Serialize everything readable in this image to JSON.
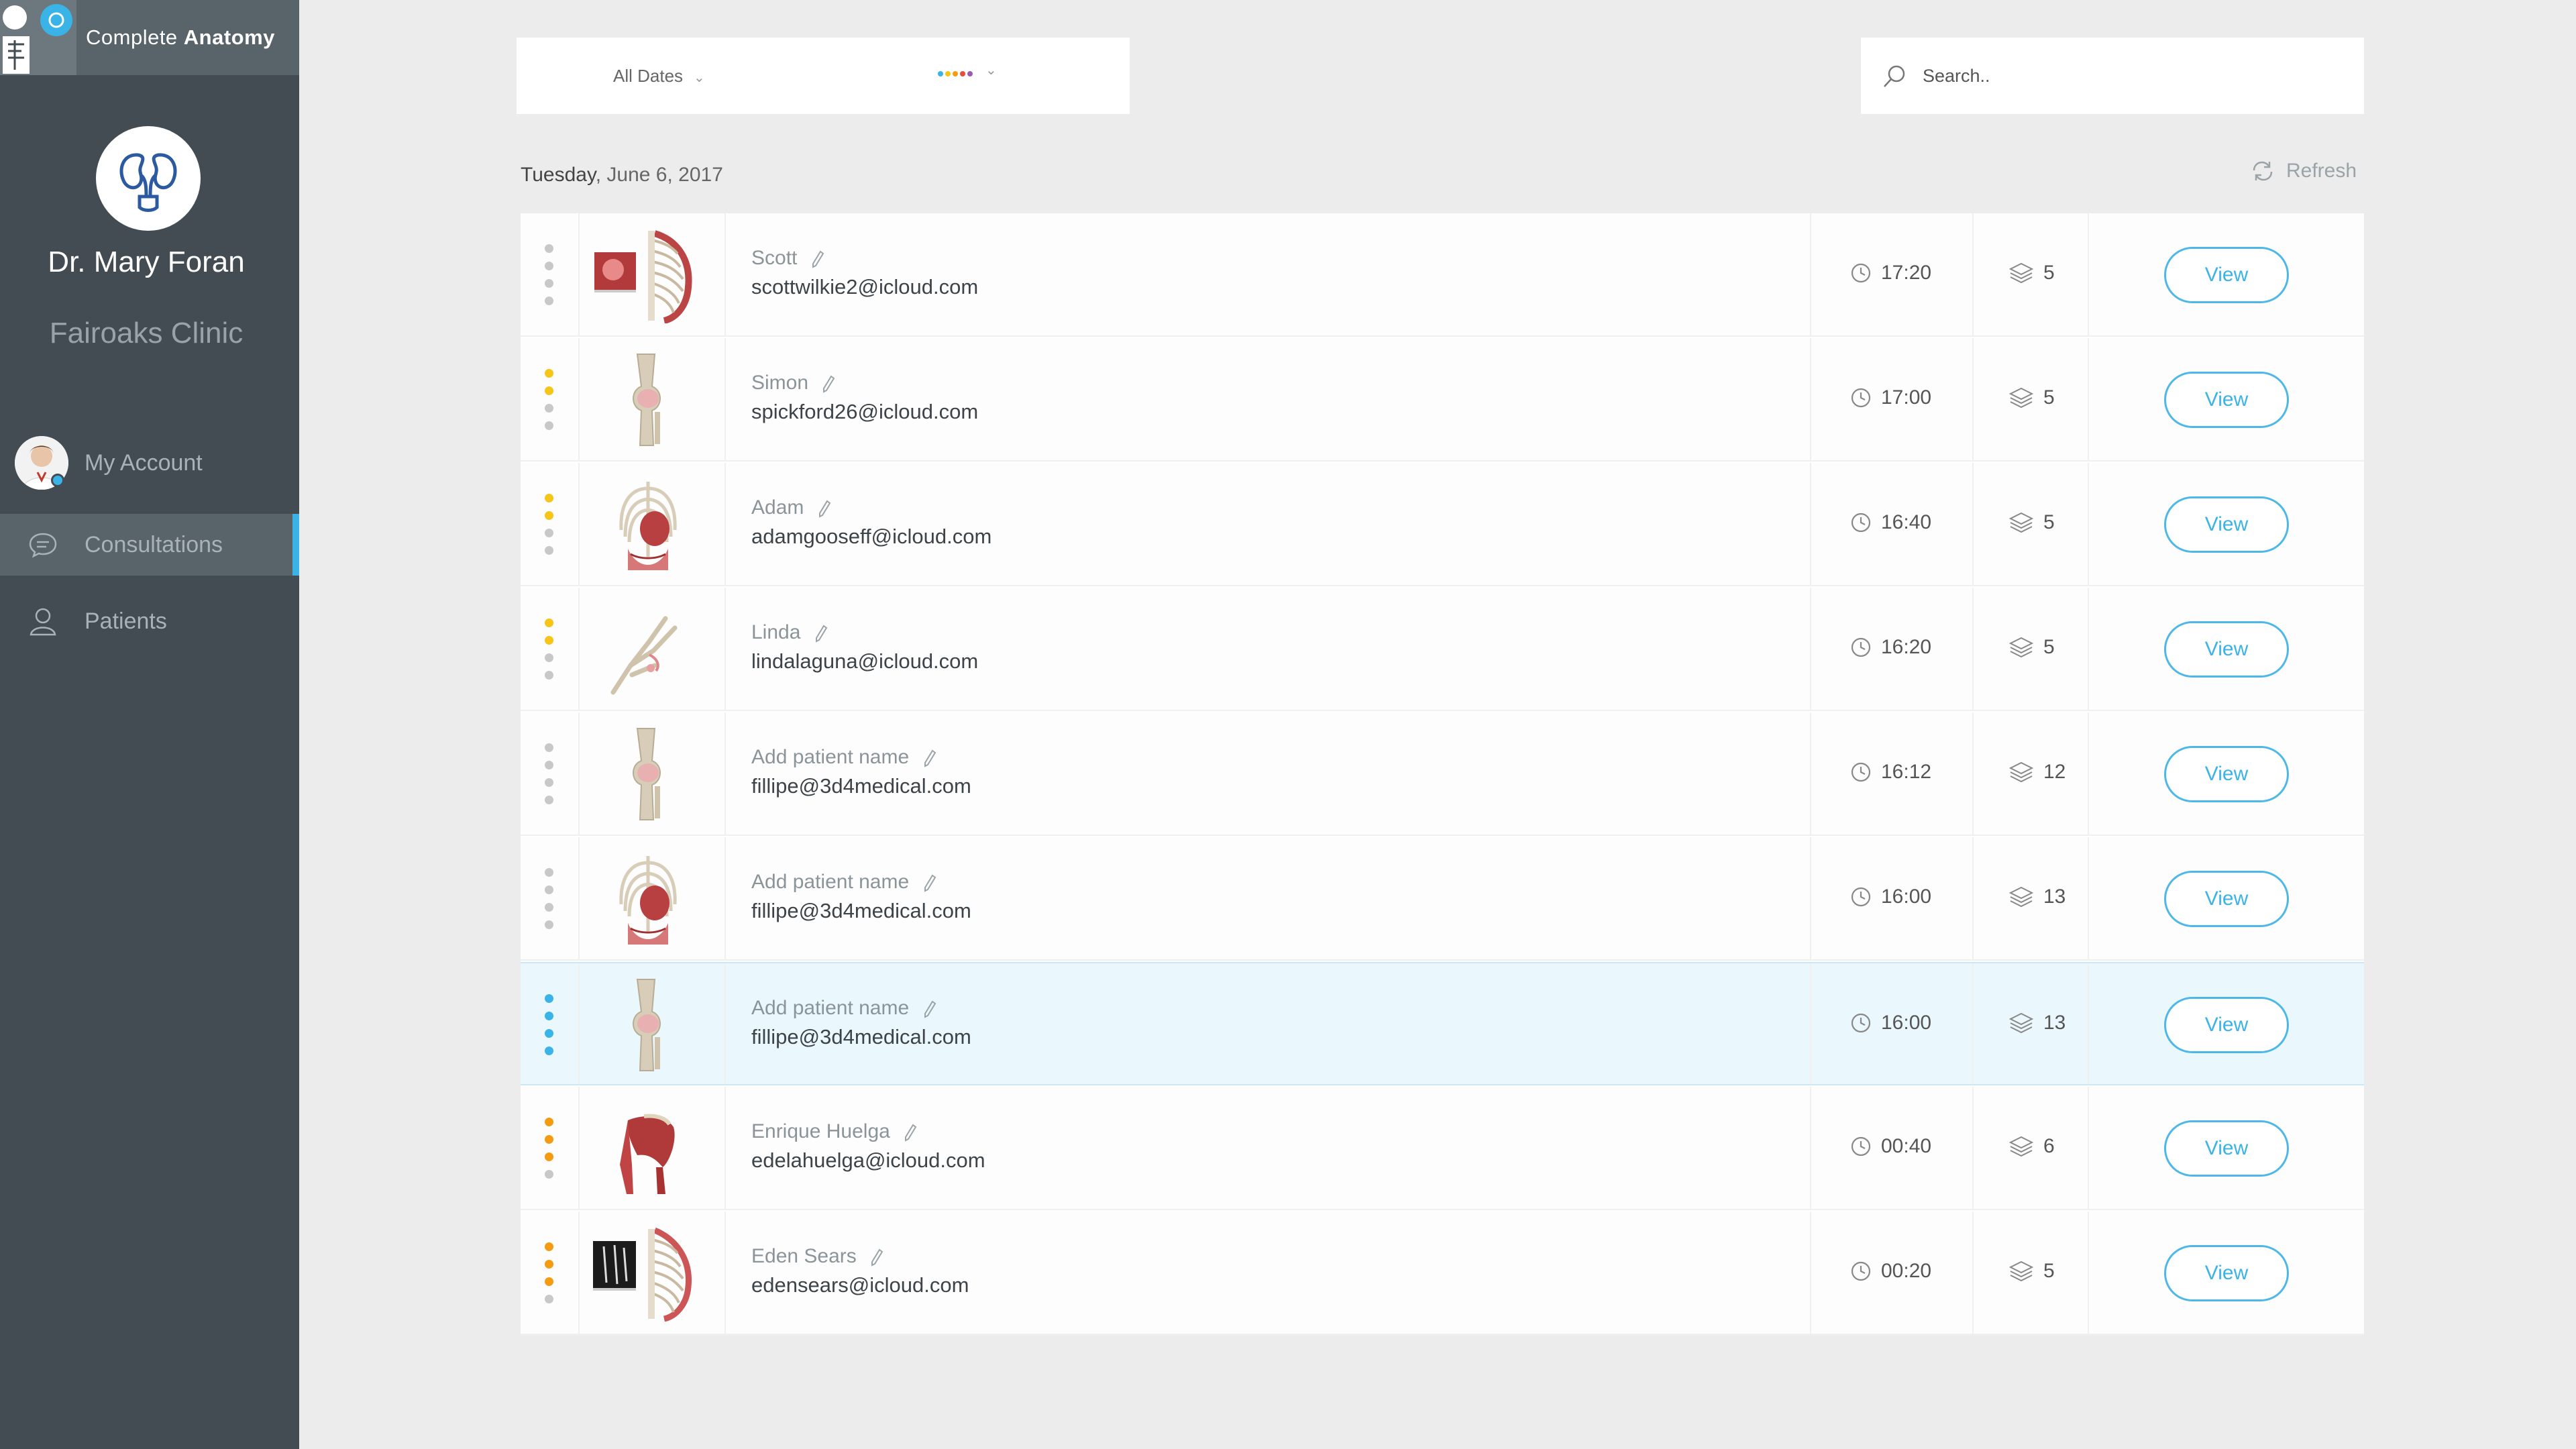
{
  "app": {
    "title_prefix": "Complete ",
    "title_bold": "Anatomy"
  },
  "sidebar": {
    "doctor_name": "Dr. Mary Foran",
    "clinic_name": "Fairoaks Clinic",
    "nav": [
      {
        "label": "My Account",
        "icon": "user-avatar"
      },
      {
        "label": "Consultations",
        "icon": "chat-bubble-icon",
        "active": true
      },
      {
        "label": "Patients",
        "icon": "person-icon"
      }
    ]
  },
  "filters": {
    "date_label": "All Dates",
    "color_dots": [
      "#3ab3e6",
      "#f5c518",
      "#f39c12",
      "#e74c3c",
      "#9b59b6"
    ]
  },
  "search": {
    "placeholder": "Search.."
  },
  "list": {
    "date_day": "Tuesday",
    "date_rest": ", June 6, 2017",
    "refresh_label": "Refresh",
    "view_label": "View",
    "rows": [
      {
        "name": "Scott",
        "email": "scottwilkie2@icloud.com",
        "time": "17:20",
        "layers": "5",
        "dots": [
          "#c8c8c8",
          "#c8c8c8",
          "#c8c8c8",
          "#c8c8c8"
        ],
        "thumb": "spine-ribs",
        "highlight": false
      },
      {
        "name": "Simon",
        "email": "spickford26@icloud.com",
        "time": "17:00",
        "layers": "5",
        "dots": [
          "#f5c518",
          "#f5c518",
          "#c8c8c8",
          "#c8c8c8"
        ],
        "thumb": "knee",
        "highlight": false
      },
      {
        "name": "Adam",
        "email": "adamgooseff@icloud.com",
        "time": "16:40",
        "layers": "5",
        "dots": [
          "#f5c518",
          "#f5c518",
          "#c8c8c8",
          "#c8c8c8"
        ],
        "thumb": "torso",
        "highlight": false
      },
      {
        "name": "Linda",
        "email": "lindalaguna@icloud.com",
        "time": "16:20",
        "layers": "5",
        "dots": [
          "#f5c518",
          "#f5c518",
          "#c8c8c8",
          "#c8c8c8"
        ],
        "thumb": "hand",
        "highlight": false
      },
      {
        "name": "Add patient name",
        "email": "fillipe@3d4medical.com",
        "time": "16:12",
        "layers": "12",
        "dots": [
          "#c8c8c8",
          "#c8c8c8",
          "#c8c8c8",
          "#c8c8c8"
        ],
        "thumb": "knee",
        "highlight": false
      },
      {
        "name": "Add patient name",
        "email": "fillipe@3d4medical.com",
        "time": "16:00",
        "layers": "13",
        "dots": [
          "#c8c8c8",
          "#c8c8c8",
          "#c8c8c8",
          "#c8c8c8"
        ],
        "thumb": "torso",
        "highlight": false
      },
      {
        "name": "Add patient name",
        "email": "fillipe@3d4medical.com",
        "time": "16:00",
        "layers": "13",
        "dots": [
          "#3ab3e6",
          "#3ab3e6",
          "#3ab3e6",
          "#3ab3e6"
        ],
        "thumb": "knee",
        "highlight": true
      },
      {
        "name": "Enrique Huelga",
        "email": "edelahuelga@icloud.com",
        "time": "00:40",
        "layers": "6",
        "dots": [
          "#f39c12",
          "#f39c12",
          "#f39c12",
          "#c8c8c8"
        ],
        "thumb": "shoulder",
        "highlight": false
      },
      {
        "name": "Eden Sears",
        "email": "edensears@icloud.com",
        "time": "00:20",
        "layers": "5",
        "dots": [
          "#f39c12",
          "#f39c12",
          "#f39c12",
          "#c8c8c8"
        ],
        "thumb": "xray-spine",
        "highlight": false
      }
    ]
  }
}
